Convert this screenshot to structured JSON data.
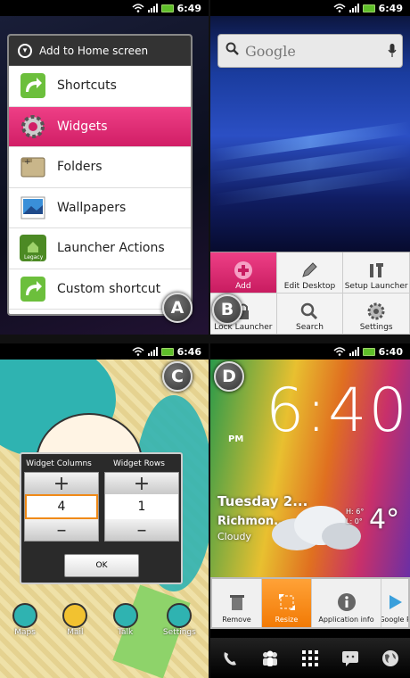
{
  "panels": {
    "a": {
      "letter": "A",
      "status_time": "6:49",
      "dialog_title": "Add to Home screen",
      "items": [
        {
          "label": "Shortcuts",
          "icon": "arrow-icon"
        },
        {
          "label": "Widgets",
          "icon": "gear-icon",
          "selected": true
        },
        {
          "label": "Folders",
          "icon": "folder-icon"
        },
        {
          "label": "Wallpapers",
          "icon": "picture-icon"
        },
        {
          "label": "Launcher Actions",
          "icon": "legacy-icon",
          "icon_text": "Legacy"
        },
        {
          "label": "Custom shortcut",
          "icon": "arrow-icon"
        }
      ]
    },
    "b": {
      "letter": "B",
      "status_time": "6:49",
      "search_text": "Google",
      "menu": [
        {
          "label": "Add",
          "icon": "plus-icon",
          "selected": true
        },
        {
          "label": "Edit Desktop",
          "icon": "pencil-icon"
        },
        {
          "label": "Setup Launcher",
          "icon": "tools-icon"
        },
        {
          "label": "Lock Launcher",
          "icon": "lock-icon"
        },
        {
          "label": "Search",
          "icon": "magnifier-icon"
        },
        {
          "label": "Settings",
          "icon": "gear-icon"
        }
      ]
    },
    "c": {
      "letter": "C",
      "status_time": "6:46",
      "columns_label": "Widget Columns",
      "rows_label": "Widget Rows",
      "columns_value": "4",
      "rows_value": "1",
      "plus": "+",
      "minus": "–",
      "ok_label": "OK",
      "dock": [
        "Maps",
        "Mail",
        "Talk",
        "Settings"
      ]
    },
    "d": {
      "letter": "D",
      "status_time": "6:40",
      "clock": "6:40",
      "ampm": "PM",
      "date": "Tuesday 2...",
      "city": "Richmon...",
      "condition": "Cloudy",
      "temp": "4°",
      "hi": "H: 6°",
      "lo": "L: 0°",
      "actions": [
        {
          "label": "Remove",
          "icon": "trash-icon"
        },
        {
          "label": "Resize",
          "icon": "resize-icon",
          "selected": true
        },
        {
          "label": "Application info",
          "icon": "info-icon"
        },
        {
          "label": "Google P",
          "icon": "play-icon"
        }
      ]
    }
  },
  "colors": {
    "pink_selected": "#e32a78",
    "orange_selected": "#f27a05",
    "battery": "#5fbf2a"
  }
}
